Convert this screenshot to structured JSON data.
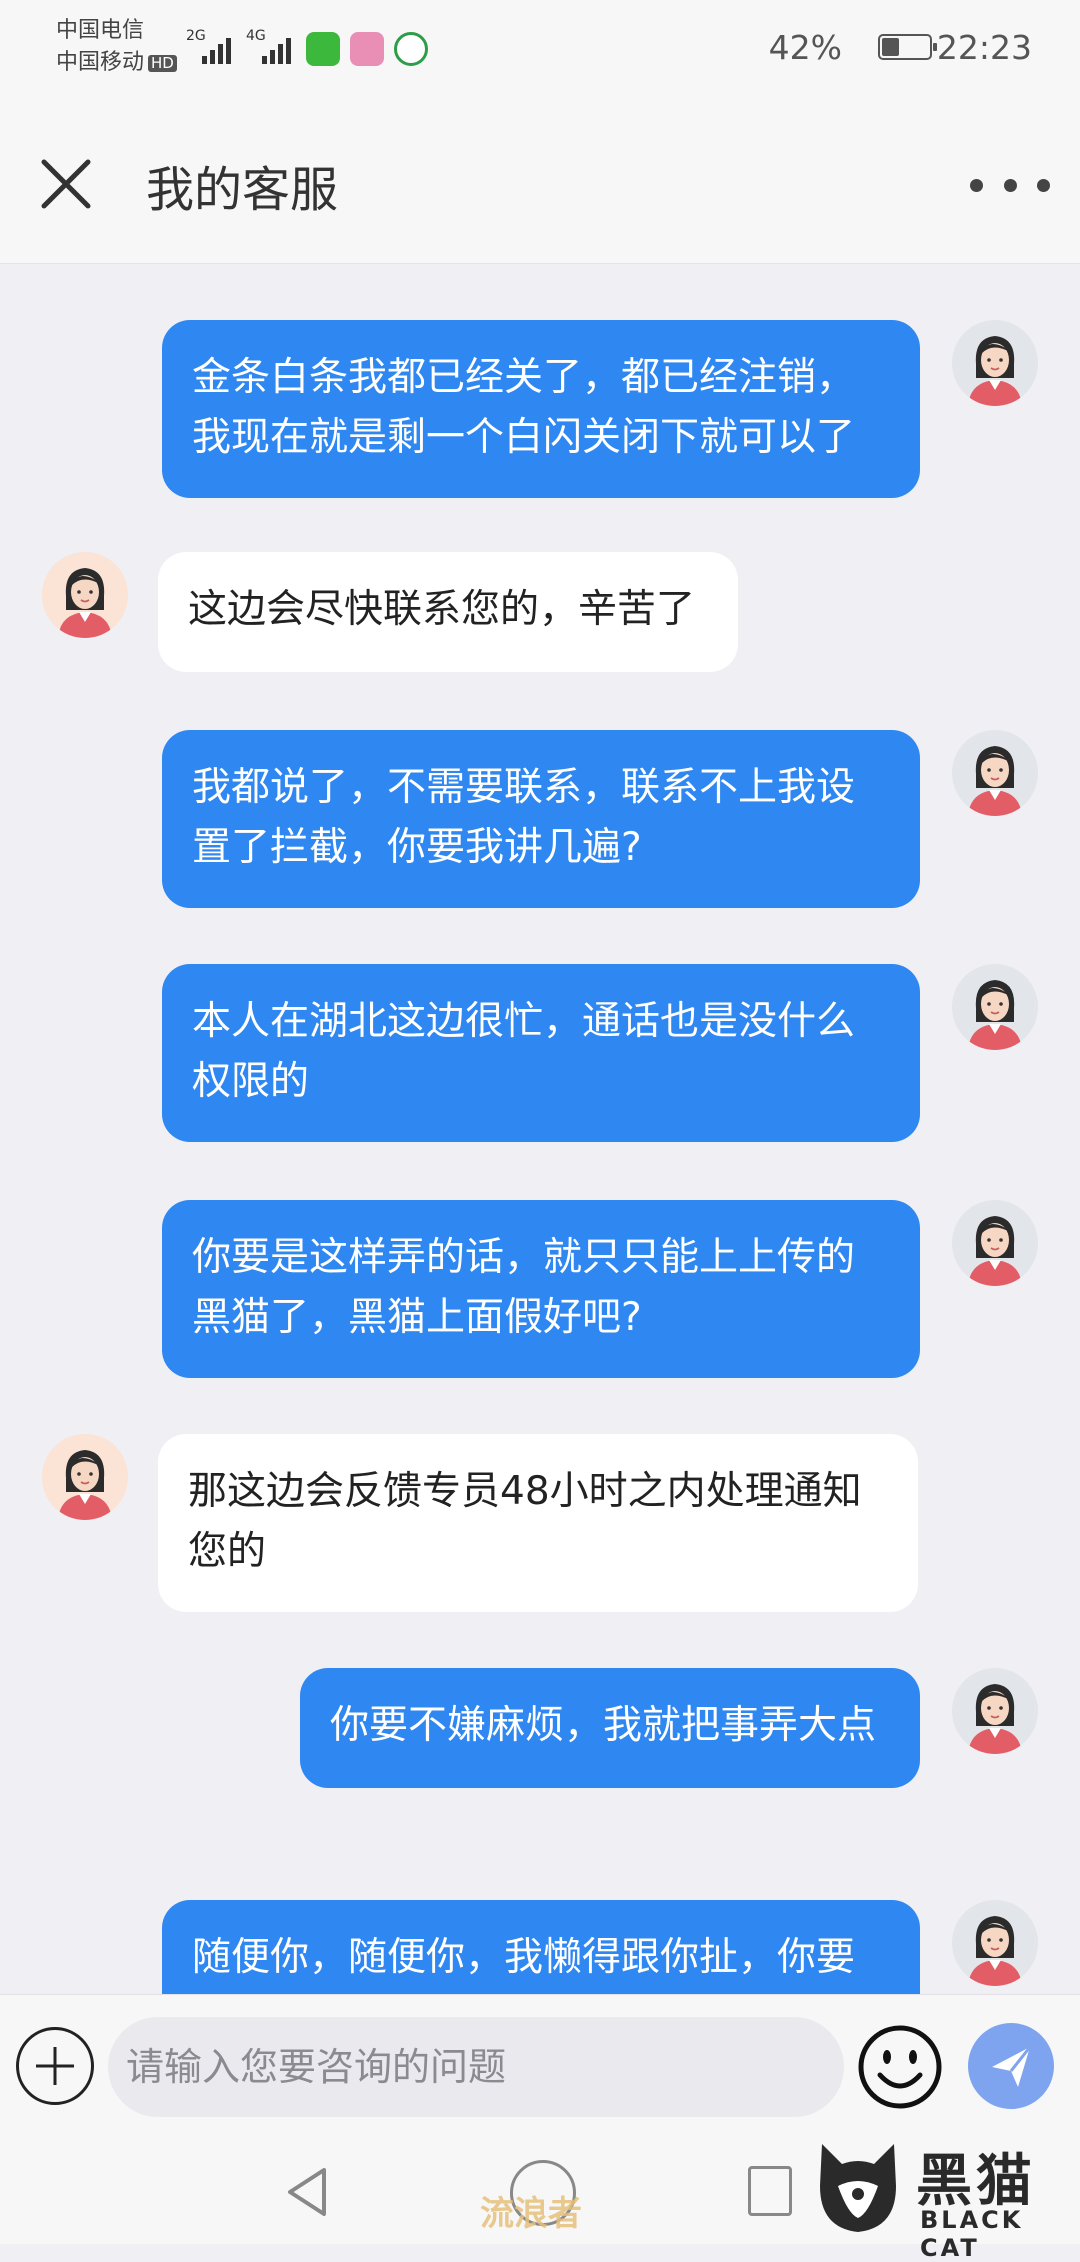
{
  "status_bar": {
    "carrier_1": "中国电信",
    "carrier_2": "中国移动",
    "hd_badge": "HD",
    "signal_1_label": "2G",
    "signal_2_label": "4G",
    "battery_percent": "42%",
    "battery_level": 0.42,
    "time": "22:23"
  },
  "header": {
    "title": "我的客服"
  },
  "messages": [
    {
      "sender": "user",
      "text": "金条白条我都已经关了，都已经注销，我现在就是剩一个白闪关闭下就可以了"
    },
    {
      "sender": "agent",
      "text": "这边会尽快联系您的，辛苦了"
    },
    {
      "sender": "user",
      "text": "我都说了，不需要联系，联系不上我设置了拦截，你要我讲几遍?"
    },
    {
      "sender": "user",
      "text": "本人在湖北这边很忙，通话也是没什么权限的"
    },
    {
      "sender": "user",
      "text": "你要是这样弄的话，就只只能上上传的黑猫了，黑猫上面假好吧?"
    },
    {
      "sender": "agent",
      "text": "那这边会反馈专员48小时之内处理通知您的"
    },
    {
      "sender": "user",
      "text": "你要不嫌麻烦，我就把事弄大点"
    },
    {
      "sender": "user",
      "text": "随便你，随便你，我懒得跟你扯，你要是不给我关闭，我反正直接上传黑猫"
    }
  ],
  "input_bar": {
    "placeholder": "请输入您要咨询的问题"
  },
  "watermark": {
    "center_text": "流浪者",
    "logo_cn": "黑猫",
    "logo_en": "BLACK CAT"
  }
}
